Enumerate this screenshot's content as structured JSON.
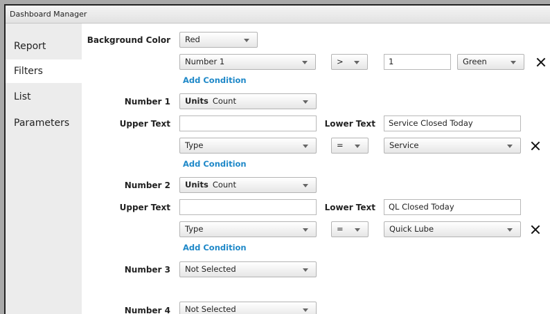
{
  "window": {
    "title": "Dashboard Manager"
  },
  "sidebar": {
    "items": [
      {
        "label": "Report"
      },
      {
        "label": "Filters"
      },
      {
        "label": "List"
      },
      {
        "label": "Parameters"
      }
    ]
  },
  "background": {
    "label": "Background Color",
    "value": "Red",
    "condition": {
      "field": "Number 1",
      "operator": ">",
      "value": "1",
      "color": "Green"
    },
    "add_condition": "Add Condition"
  },
  "labels": {
    "upper_text": "Upper Text",
    "lower_text": "Lower Text",
    "units_prefix": "Units"
  },
  "numbers": [
    {
      "label": "Number 1",
      "units": "Count",
      "upper_text": "",
      "lower_text": "Service Closed Today",
      "condition": {
        "field": "Type",
        "operator": "=",
        "value": "Service"
      },
      "add_condition": "Add Condition"
    },
    {
      "label": "Number 2",
      "units": "Count",
      "upper_text": "",
      "lower_text": "QL Closed Today",
      "condition": {
        "field": "Type",
        "operator": "=",
        "value": "Quick Lube"
      },
      "add_condition": "Add Condition"
    },
    {
      "label": "Number 3",
      "value": "Not Selected"
    },
    {
      "label": "Number 4",
      "value": "Not Selected"
    }
  ],
  "icons": {
    "remove": "close-icon",
    "dropdown": "chevron-down-icon"
  }
}
